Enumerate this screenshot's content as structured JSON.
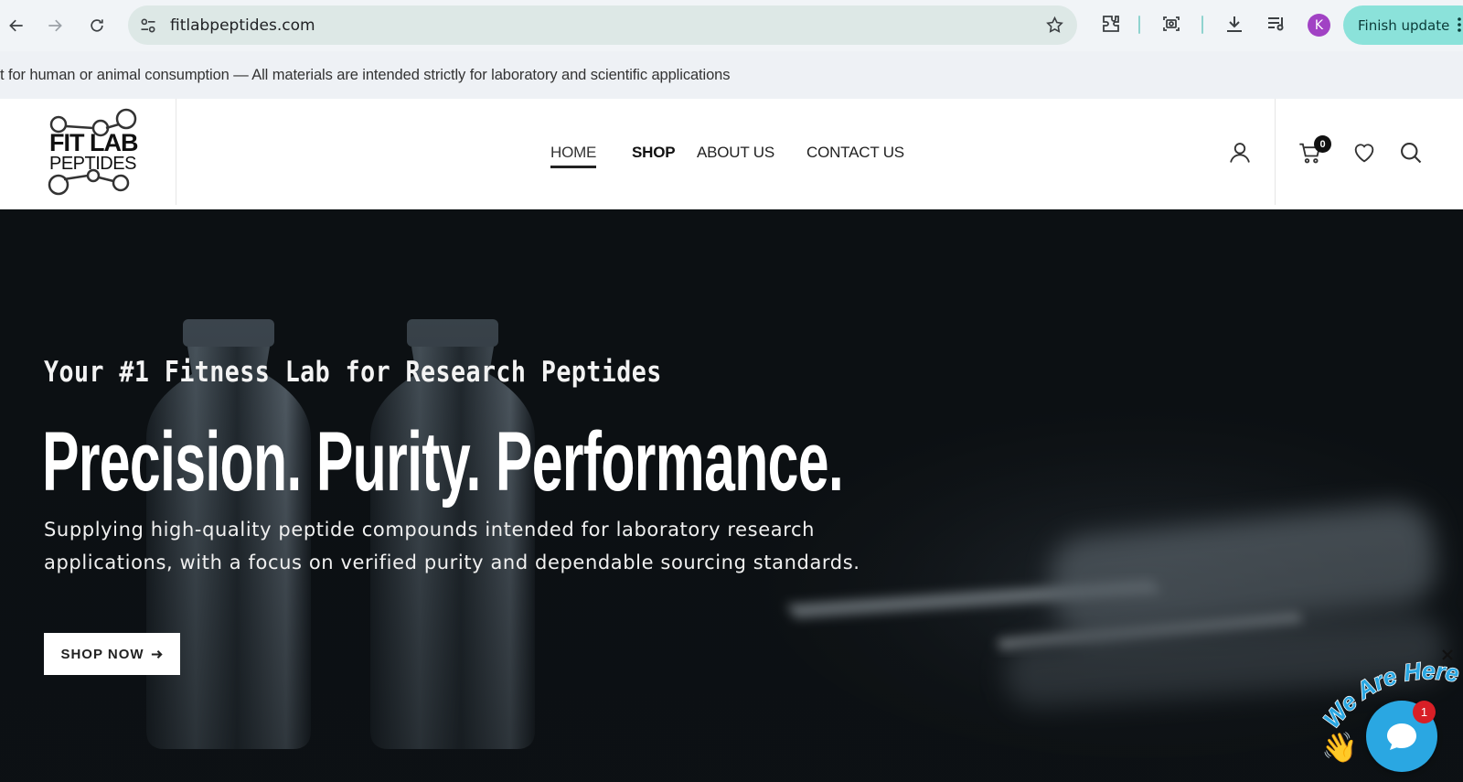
{
  "browser": {
    "url": "fitlabpeptides.com",
    "profile_initial": "K",
    "update_label": "Finish update"
  },
  "ticker": {
    "text": "t for human or animal consumption — All materials are intended strictly for laboratory and scientific applications"
  },
  "header": {
    "logo_line1": "FIT LAB",
    "logo_line2": "PEPTIDES",
    "nav": [
      {
        "label": "HOME"
      },
      {
        "label": "SHOP"
      },
      {
        "label": "ABOUT US"
      },
      {
        "label": "CONTACT US"
      }
    ],
    "cart_count": "0"
  },
  "hero": {
    "tagline": "Your #1 Fitness Lab for Research Peptides",
    "headline": "Precision. Purity. Performance.",
    "description": "Supplying high-quality peptide compounds intended for laboratory research applications, with a focus on verified purity and dependable sourcing standards.",
    "cta_label": "SHOP NOW"
  },
  "chat": {
    "banner": "We Are Here!",
    "badge_count": "1"
  },
  "colors": {
    "omnibox": "#dde8e6",
    "update_button": "#8be2da",
    "profile": "#a142c4",
    "chat_bubble": "#2aa7e2",
    "chat_badge": "#d81f26",
    "hero_bg": "#0d1114"
  }
}
